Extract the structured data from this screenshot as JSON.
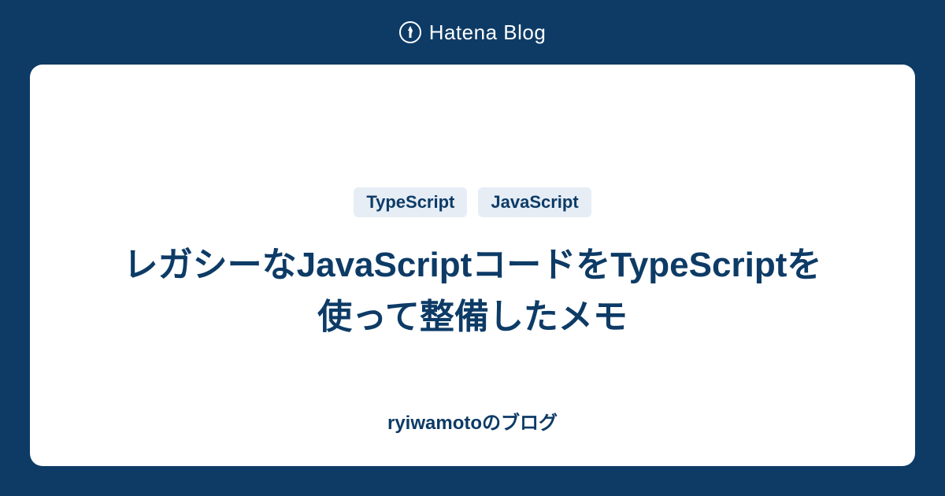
{
  "header": {
    "brand": "Hatena Blog"
  },
  "card": {
    "tags": [
      "TypeScript",
      "JavaScript"
    ],
    "title": "レガシーなJavaScriptコードをTypeScriptを使って整備したメモ",
    "blog_name": "ryiwamotoのブログ"
  }
}
